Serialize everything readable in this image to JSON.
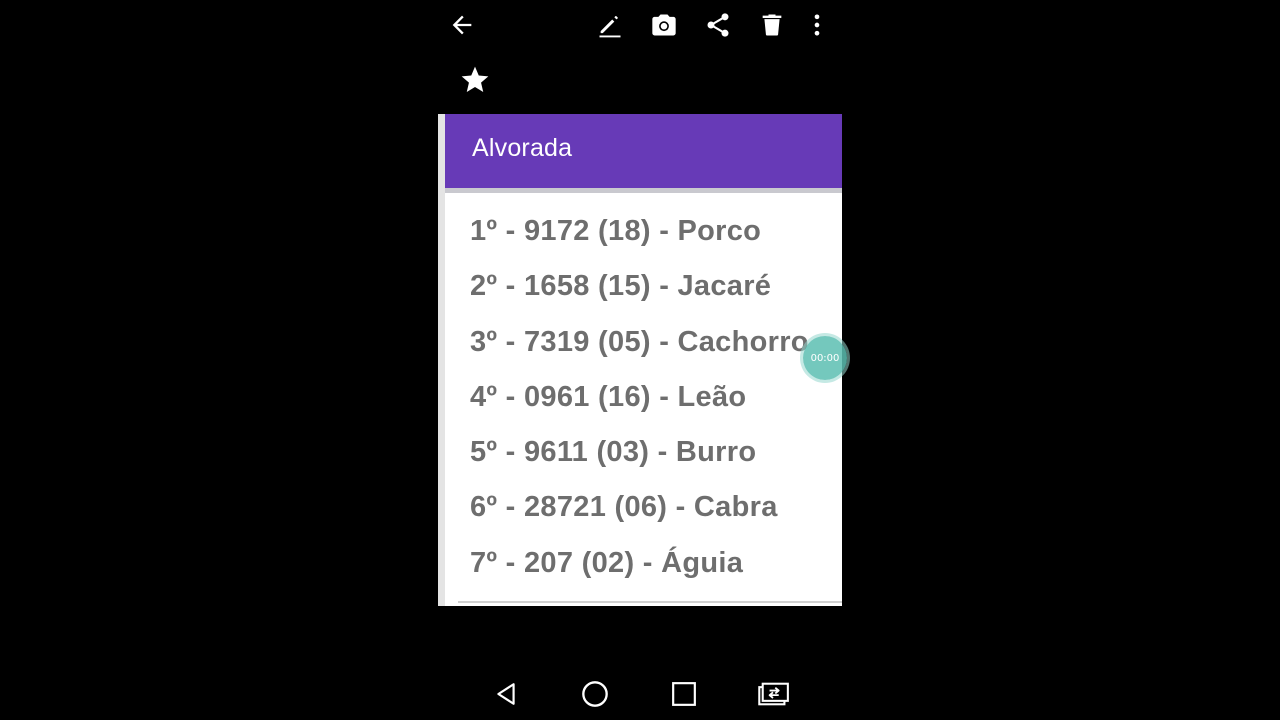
{
  "toolbar": {
    "icons": [
      "arrow-left-icon",
      "pencil-icon",
      "camera-icon",
      "share-icon",
      "trash-icon",
      "more-vert-icon",
      "star-icon"
    ]
  },
  "card": {
    "title": "Alvorada",
    "header_color": "#673ab7",
    "results": [
      "1º - 9172 (18) - Porco",
      "2º - 1658 (15) - Jacaré",
      "3º - 7319 (05) - Cachorro",
      "4º - 0961 (16) - Leão",
      "5º - 9611 (03) - Burro",
      "6º - 28721 (06) - Cabra",
      "7º - 207 (02) - Águia"
    ]
  },
  "recorder": {
    "time": "00:00",
    "color": "#5cbeb2"
  },
  "navbar": {
    "icons": [
      "triangle-back-icon",
      "circle-home-icon",
      "square-recents-icon",
      "screen-rotate-icon"
    ]
  }
}
